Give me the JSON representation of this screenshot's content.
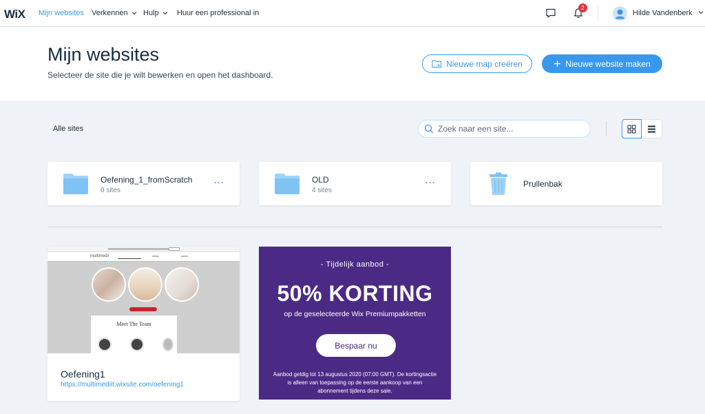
{
  "topnav": {
    "logo": "WiX",
    "items": [
      {
        "label": "Mijn websites"
      },
      {
        "label": "Verkennen"
      },
      {
        "label": "Hulp"
      },
      {
        "label": "Huur een professional in"
      }
    ],
    "notification_count": "2",
    "user_name": "Hilde Vandenberk"
  },
  "header": {
    "title": "Mijn websites",
    "subtitle": "Selecteer de site die je wilt bewerken en open het dashboard.",
    "new_folder_label": "Nieuwe map creëren",
    "new_site_label": "Nieuwe website maken"
  },
  "toolbar": {
    "filter_label": "Alle sites",
    "search_placeholder": "Zoek naar een site..."
  },
  "folders": [
    {
      "name": "Oefening_1_fromScratch",
      "count": "0 sites"
    },
    {
      "name": "OLD",
      "count": "4 sites"
    }
  ],
  "trash": {
    "name": "Prullenbak"
  },
  "sites": [
    {
      "name": "Oefening1",
      "url": "https://multimediit.wixsite.com/oefening1",
      "thumbnail": {
        "logo": "multimedii",
        "heading": "Meet The Team"
      }
    }
  ],
  "promo": {
    "label": "- Tijdelijk aanbod -",
    "title": "50% KORTING",
    "subtitle": "op de geselecteerde Wix Premiumpakketten",
    "button_label": "Bespaar nu",
    "fine_print": "Aanbod geldig tot 13 augustus 2020 (07:00 GMT). De kortingsactie is alleen van toepassing op de eerste aankoop van een abonnement tijdens deze sale."
  },
  "colors": {
    "accent": "#3899ec",
    "promo_bg": "#4b2a86",
    "badge": "#e0343b",
    "folder": "#7fc3f4"
  }
}
